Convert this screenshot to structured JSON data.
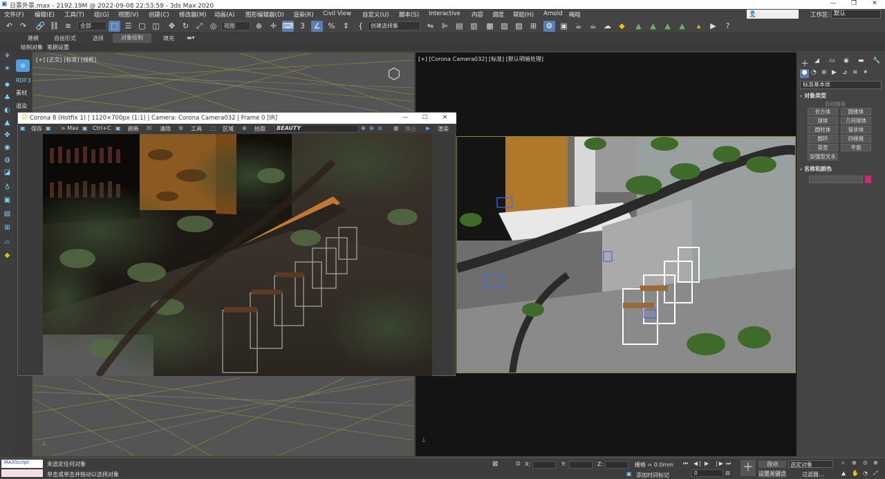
{
  "window": {
    "title": "日景外景.max - 2192.19M @ 2022-09-08 22:53:59 - 3ds Max 2020"
  },
  "menu": [
    "文件(F)",
    "编辑(E)",
    "工具(T)",
    "组(G)",
    "视图(V)",
    "创建(C)",
    "修改器(M)",
    "动画(A)",
    "图形编辑器(D)",
    "渲染(R)",
    "Civil View",
    "自定义(U)",
    "脚本(S)",
    "Interactive",
    "内容",
    "调度",
    "帮助(H)",
    "Arnold",
    "晦晗"
  ],
  "login": "登录",
  "workspace": {
    "label": "工作区:",
    "value": "默认"
  },
  "toolbar": {
    "filter": "全部",
    "coord": "视图",
    "selset": "创建选择集"
  },
  "ribbon": {
    "tabs": [
      "建模",
      "自由形式",
      "选择",
      "对象绘制",
      "填充"
    ],
    "active": "对象绘制"
  },
  "subribbon": [
    "绘制对象",
    "笔刷设置"
  ],
  "side_labels": [
    "RDF3",
    "素材",
    "道染"
  ],
  "viewport1": {
    "label": "[+] [正交] [标准] [线框]"
  },
  "viewport2": {
    "label": "[+] [Corona Camera032] [标准] [默认明暗处理]"
  },
  "vfb": {
    "title": "Corona 8 (Hotfix 1) | 1120×700px (1:1) | Camera: Corona Camera032 | Frame 0 [IR]",
    "tools": [
      "保存",
      "> Max",
      "Ctrl+C",
      "刷新",
      "清除",
      "工具",
      "区域",
      "拾取"
    ],
    "channel": "BEAUTY",
    "stop": "停止",
    "render": "渲染"
  },
  "cmdpanel": {
    "category": "标准基本体",
    "rollout_object_type": "对象类型",
    "autogrid": "自动栅格",
    "buttons": [
      "长方体",
      "圆锥体",
      "球体",
      "几何球体",
      "圆柱体",
      "管状体",
      "圆环",
      "四棱锥",
      "茶壶",
      "平面",
      "加强型文本"
    ],
    "rollout_name_color": "名称和颜色",
    "color": "#d6266e"
  },
  "status": {
    "line1": "未选定任何对象",
    "line2": "单击或单击并拖动以选择对象",
    "x": "X:",
    "y": "Y:",
    "z": "Z:",
    "grid": "栅格 = 0.0mm",
    "addtime": "添加时间标记",
    "auto": "自动",
    "selobj": "选定对象",
    "setkey": "设置关键点",
    "filter": "过滤器...",
    "frame": "0",
    "maxscript": "MAXScript"
  }
}
